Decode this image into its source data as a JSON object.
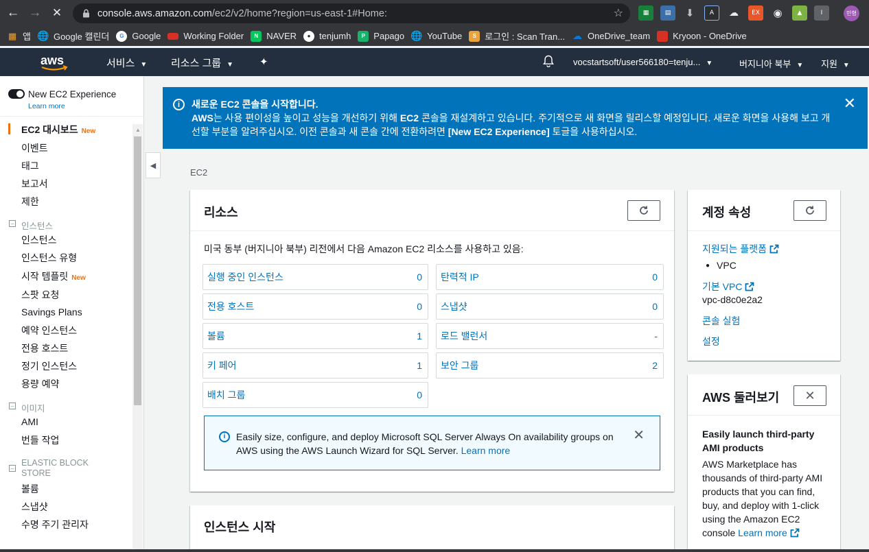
{
  "browser": {
    "url_host": "console.aws.amazon.com",
    "url_path": "/ec2/v2/home?region=us-east-1#Home:",
    "profile_label": "민형",
    "bookmarks": [
      {
        "label": "앱",
        "color": "#4285f4"
      },
      {
        "label": "Google 캘린더",
        "color": "#ffffff"
      },
      {
        "label": "Google",
        "color": "#ffffff"
      },
      {
        "label": "Working Folder",
        "color": "#d93025"
      },
      {
        "label": "NAVER",
        "color": "#03c75a",
        "glyph": "N"
      },
      {
        "label": "tenjumh",
        "color": "#ffffff"
      },
      {
        "label": "Papago",
        "color": "#16b36b"
      },
      {
        "label": "YouTube",
        "color": "#ffffff"
      },
      {
        "label": "로그인 : Scan Tran...",
        "color": "#e8a33d"
      },
      {
        "label": "OneDrive_team",
        "color": "#0a78d4"
      },
      {
        "label": "Kryoon - OneDrive",
        "color": "#d93025"
      }
    ]
  },
  "awsnav": {
    "services": "서비스",
    "resource_groups": "리소스 그룹",
    "account": "vocstartsoft/user566180=tenju...",
    "region": "버지니아 북부",
    "support": "지원"
  },
  "sidebar": {
    "toggle_label": "New EC2 Experience",
    "toggle_learn": "Learn more",
    "new_badge": "New",
    "dashboard": "EC2 대시보드",
    "items_top": [
      "이벤트",
      "태그",
      "보고서",
      "제한"
    ],
    "sec_instances": "인스턴스",
    "instances": [
      "인스턴스",
      "인스턴스 유형",
      "시작 템플릿",
      "스팟 요청",
      "Savings Plans",
      "예약 인스턴스",
      "전용 호스트",
      "정기 인스턴스",
      "용량 예약"
    ],
    "sec_images": "이미지",
    "images": [
      "AMI",
      "번들 작업"
    ],
    "sec_ebs": [
      "ELASTIC BLOCK",
      "STORE"
    ],
    "ebs": [
      "볼륨",
      "스냅샷",
      "수명 주기 관리자"
    ]
  },
  "banner": {
    "title": "새로운 EC2 콘솔을 시작합니다.",
    "body_bold": "AWS",
    "body_1": "는 사용 편이성을 높이고 성능을 개선하기 위해 ",
    "body_bold2": "EC2",
    "body_2": " 콘솔을 재설계하고 있습니다. 주기적으로 새 화면을 릴리스할 예정입니다. 새로운 화면을 사용해 보고 개선할 부분을 알려주십시오. 이전 콘솔과 새 콘솔 간에 전환하려면 ",
    "body_bold3": "[New EC2 Experience]",
    "body_3": " 토글을 사용하십시오."
  },
  "breadcrumb": "EC2",
  "resources": {
    "title": "리소스",
    "intro": "미국 동부 (버지니아 북부) 리전에서 다음 Amazon EC2 리소스를 사용하고 있음:",
    "left": [
      {
        "label": "실행 중인 인스턴스",
        "value": "0"
      },
      {
        "label": "전용 호스트",
        "value": "0"
      },
      {
        "label": "볼륨",
        "value": "1"
      },
      {
        "label": "키 페어",
        "value": "1"
      },
      {
        "label": "배치 그룹",
        "value": "0"
      }
    ],
    "right": [
      {
        "label": "탄력적 IP",
        "value": "0"
      },
      {
        "label": "스냅샷",
        "value": "0"
      },
      {
        "label": "로드 밸런서",
        "value": "-"
      },
      {
        "label": "보안 그룹",
        "value": "2"
      }
    ],
    "sql_info": "Easily size, configure, and deploy Microsoft SQL Server Always On availability groups on AWS using the AWS Launch Wizard for SQL Server.",
    "sql_learn": "Learn more"
  },
  "launch": {
    "title": "인스턴스 시작"
  },
  "account_attrs": {
    "title": "계정 속성",
    "platforms": "지원되는 플랫폼",
    "vpc_bullet": "VPC",
    "default_vpc": "기본 VPC",
    "vpc_id": "vpc-d8c0e2a2",
    "console_exp": "콘솔 실험",
    "settings": "설정"
  },
  "explore": {
    "title": "AWS 둘러보기",
    "heading": "Easily launch third-party AMI products",
    "body": "AWS Marketplace has thousands of third-party AMI products that you can find, buy, and deploy with 1-click using the Amazon EC2 console",
    "learn": "Learn more"
  },
  "colors": {
    "aws_nav": "#232f3e",
    "banner": "#0073bb",
    "accent": "#ec7211",
    "link": "#0073bb"
  }
}
